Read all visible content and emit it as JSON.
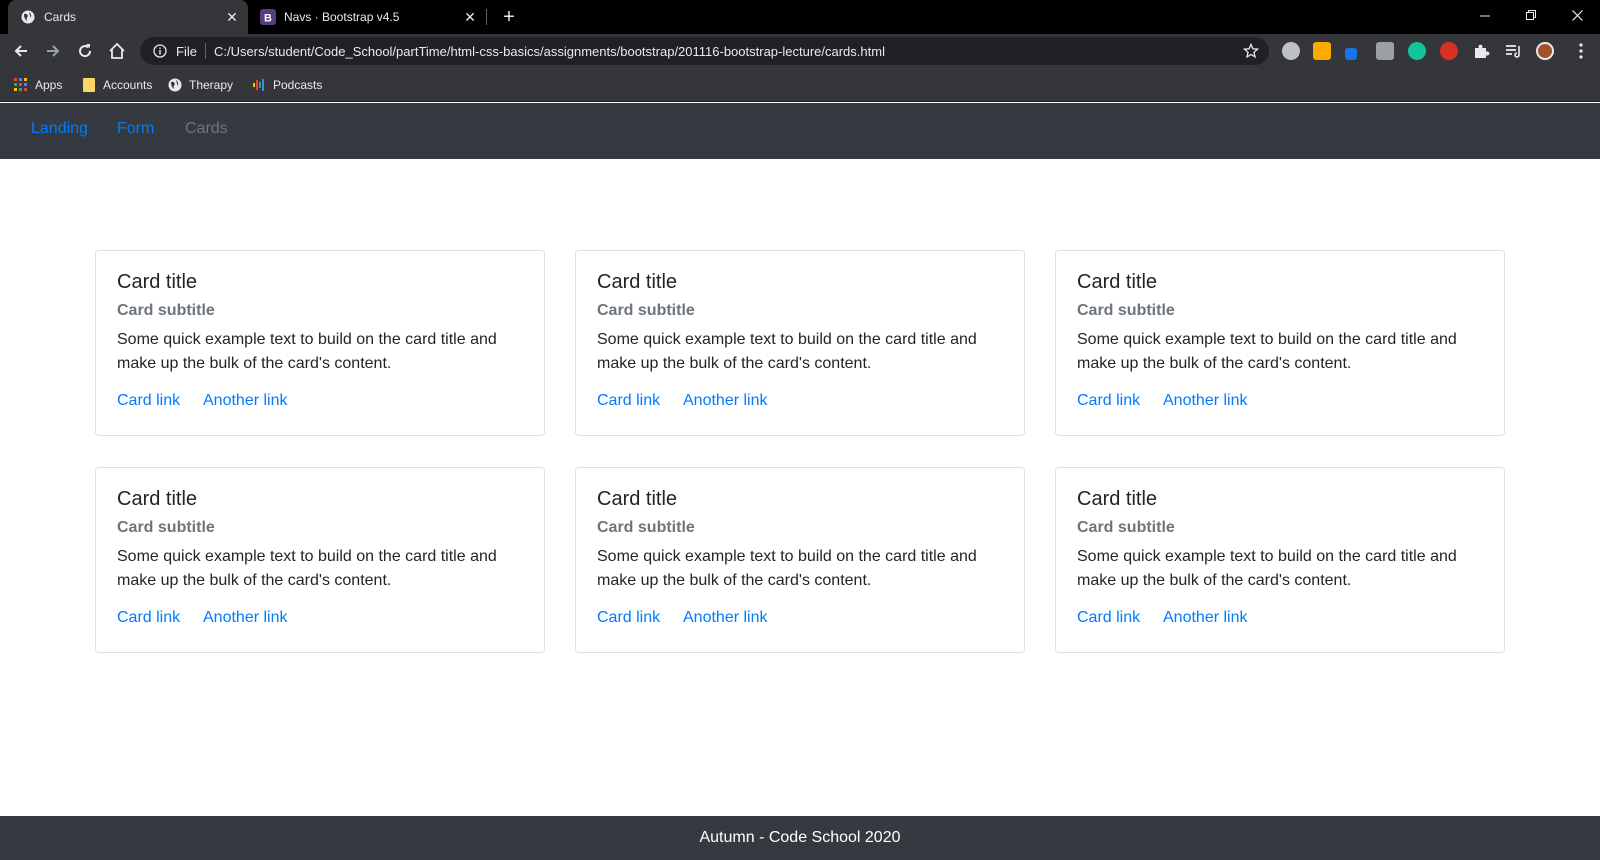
{
  "browser": {
    "tabs": [
      {
        "title": "Cards",
        "icon": "globe-icon",
        "active": true
      },
      {
        "title": "Navs · Bootstrap v4.5",
        "icon": "bootstrap-icon",
        "icon_letter": "B",
        "active": false
      }
    ],
    "address": {
      "scheme": "File",
      "url": "C:/Users/student/Code_School/partTime/html-css-basics/assignments/bootstrap/201116-bootstrap-lecture/cards.html"
    },
    "bookmarks": [
      {
        "label": "Apps",
        "icon": "apps-grid-icon"
      },
      {
        "label": "Accounts",
        "icon": "folder-icon"
      },
      {
        "label": "Therapy",
        "icon": "globe-icon"
      },
      {
        "label": "Podcasts",
        "icon": "podcasts-icon"
      }
    ],
    "colors": {
      "tabstrip": "#000000",
      "toolbar": "#35363a",
      "omnibox": "#202124"
    }
  },
  "site": {
    "nav": [
      {
        "label": "Landing",
        "state": "link"
      },
      {
        "label": "Form",
        "state": "link"
      },
      {
        "label": "Cards",
        "state": "disabled"
      }
    ],
    "cards": [
      {
        "title": "Card title",
        "subtitle": "Card subtitle",
        "text": "Some quick example text to build on the card title and make up the bulk of the card's content.",
        "link1": "Card link",
        "link2": "Another link"
      },
      {
        "title": "Card title",
        "subtitle": "Card subtitle",
        "text": "Some quick example text to build on the card title and make up the bulk of the card's content.",
        "link1": "Card link",
        "link2": "Another link"
      },
      {
        "title": "Card title",
        "subtitle": "Card subtitle",
        "text": "Some quick example text to build on the card title and make up the bulk of the card's content.",
        "link1": "Card link",
        "link2": "Another link"
      },
      {
        "title": "Card title",
        "subtitle": "Card subtitle",
        "text": "Some quick example text to build on the card title and make up the bulk of the card's content.",
        "link1": "Card link",
        "link2": "Another link"
      },
      {
        "title": "Card title",
        "subtitle": "Card subtitle",
        "text": "Some quick example text to build on the card title and make up the bulk of the card's content.",
        "link1": "Card link",
        "link2": "Another link"
      },
      {
        "title": "Card title",
        "subtitle": "Card subtitle",
        "text": "Some quick example text to build on the card title and make up the bulk of the card's content.",
        "link1": "Card link",
        "link2": "Another link"
      }
    ],
    "footer": "Autumn - Code School 2020",
    "colors": {
      "navbar": "#343a40",
      "link": "#007bff",
      "muted": "#6c757d",
      "text": "#212529"
    }
  }
}
